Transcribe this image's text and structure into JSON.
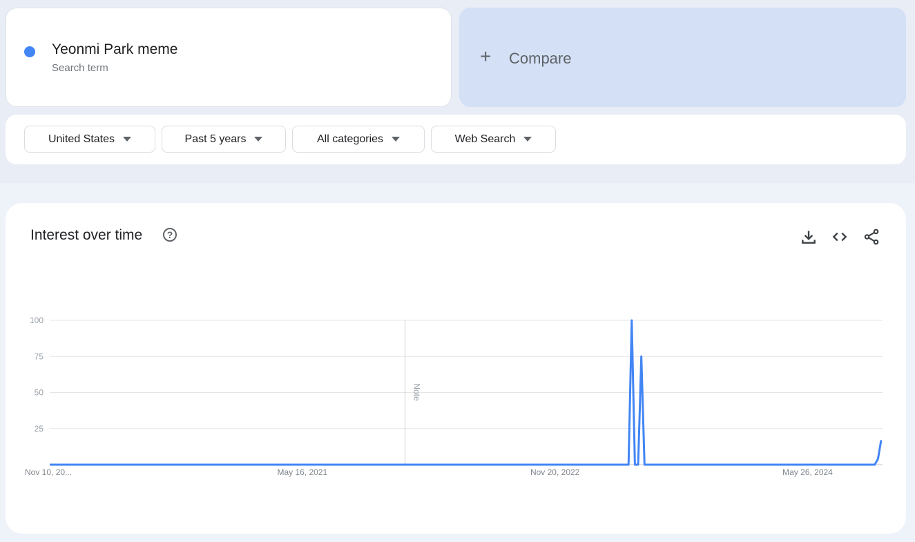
{
  "search_term": {
    "name": "Yeonmi Park meme",
    "subtitle": "Search term",
    "color": "#4285f4"
  },
  "compare": {
    "icon": "plus-icon",
    "label": "Compare"
  },
  "filters": [
    {
      "label": "United States"
    },
    {
      "label": "Past 5 years"
    },
    {
      "label": "All categories"
    },
    {
      "label": "Web Search"
    }
  ],
  "panel": {
    "title": "Interest over time",
    "help_icon": "?",
    "tools": [
      "download-icon",
      "embed-code-icon",
      "share-icon"
    ]
  },
  "chart_data": {
    "type": "line",
    "title": "Interest over time",
    "xlabel": "",
    "ylabel": "",
    "ylim": [
      0,
      100
    ],
    "yticks": [
      25,
      50,
      75,
      100
    ],
    "grid": true,
    "legend": "none",
    "line_color": "#4285f4",
    "x_start": "Nov 10, 2019",
    "x_tick_labels": [
      "Nov 10, 20...",
      "May 16, 2021",
      "Nov 20, 2022",
      "May 26, 2024"
    ],
    "x_tick_indices": [
      0,
      79,
      158,
      237
    ],
    "annotation": {
      "label": "Note",
      "index": 111
    },
    "num_points": 261,
    "series": [
      {
        "name": "Yeonmi Park meme",
        "nonzero_points": [
          {
            "index": 182,
            "value": 100
          },
          {
            "index": 185,
            "value": 75
          },
          {
            "index": 259,
            "value": 4
          },
          {
            "index": 260,
            "value": 17
          }
        ],
        "default_value": 0
      }
    ]
  }
}
